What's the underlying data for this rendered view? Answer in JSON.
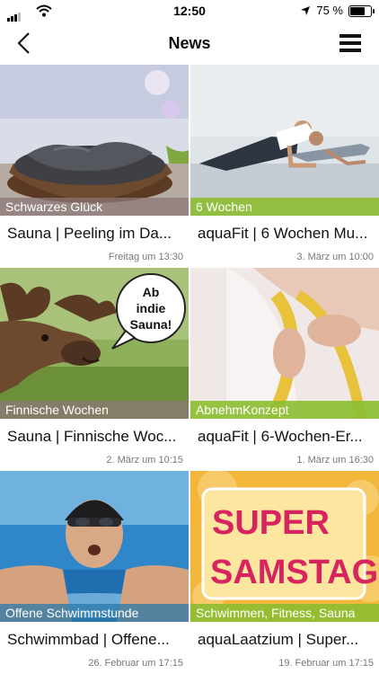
{
  "status_bar": {
    "time": "12:50",
    "battery": "75 %"
  },
  "header": {
    "title": "News"
  },
  "cards": [
    {
      "tag": "Schwarzes Glück",
      "title": "Sauna | Peeling im Da...",
      "date": "Freitag um 13:30"
    },
    {
      "tag": "6 Wochen",
      "title": "aquaFit | 6 Wochen Mu...",
      "date": "3. März um 10:00"
    },
    {
      "tag": "Finnische Wochen",
      "title": "Sauna | Finnische Woc...",
      "date": "2. März um 10:15",
      "bubble": [
        "Ab",
        "indie",
        "Sauna!"
      ]
    },
    {
      "tag": "AbnehmKonzept",
      "title": "aquaFit | 6-Wochen-Er...",
      "date": "1. März um 16:30"
    },
    {
      "tag": "Offene Schwimmstunde",
      "title": "Schwimmbad | Offene...",
      "date": "26. Februar um 17:15"
    },
    {
      "tag": "Schwimmen, Fitness, Sauna",
      "title": "aquaLaatzium | Super...",
      "date": "19. Februar um 17:15",
      "poster": [
        "SUPER",
        "SAMSTAG"
      ]
    }
  ],
  "colors": {
    "tag_green": "#8cbe32",
    "tag_grey": "#8c7878",
    "poster_pink": "#d8245e",
    "poster_bg": "#f2b63a"
  }
}
